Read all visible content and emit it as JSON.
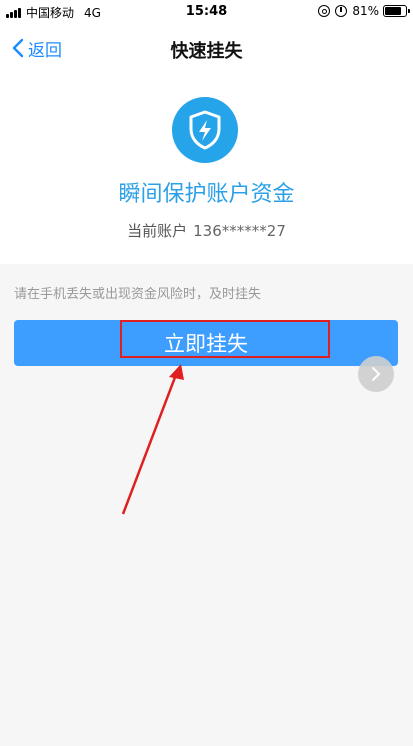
{
  "status_bar": {
    "carrier": "中国移动",
    "network": "4G",
    "time": "15:48",
    "battery": "81%",
    "battery_level": 0.81
  },
  "nav": {
    "back_label": "返回",
    "title": "快速挂失"
  },
  "hero": {
    "title": "瞬间保护账户资金",
    "account_label": "当前账户",
    "account_number": "136******27"
  },
  "hint": "请在手机丢失或出现资金风险时，及时挂失",
  "action": {
    "button_label": "立即挂失"
  },
  "colors": {
    "accent": "#3d9eff",
    "brand_blue": "#25a4ea",
    "annotation_red": "#e02020"
  },
  "icons": {
    "shield": "shield-lightning-icon",
    "back": "chevron-left-icon",
    "floating": "chevron-right-icon"
  }
}
